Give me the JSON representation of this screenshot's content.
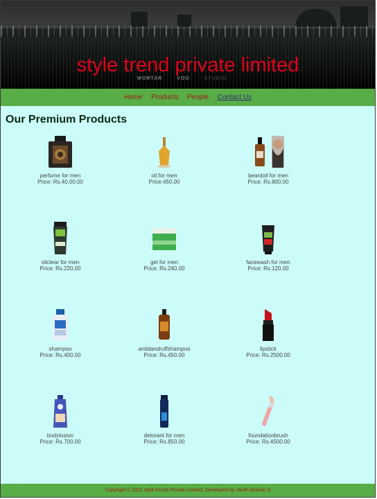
{
  "banner": {
    "title": "style trend private limited",
    "logos": [
      "MORTAR",
      "VOO",
      "STUDIO"
    ]
  },
  "nav": {
    "items": [
      "Home",
      "Products",
      "People",
      "Contact Us"
    ]
  },
  "main": {
    "heading": "Our Premium Products"
  },
  "products": [
    {
      "name": "perfume for men",
      "price": "Price: Rs.40,00.00"
    },
    {
      "name": "oil for men",
      "price": "Price:450.00"
    },
    {
      "name": "beardoil for men",
      "price": "Price: Rs.800.00"
    },
    {
      "name": "oilclear for men",
      "price": "Price: Rs.220.00"
    },
    {
      "name": "gel for men",
      "price": "Price: Rs.240.00"
    },
    {
      "name": "facewash for men",
      "price": "Price: Rs.120.00"
    },
    {
      "name": "shampoo",
      "price": "Price: Rs.400.00"
    },
    {
      "name": "antidandruffshampoo",
      "price": "Price: Rs.450.00"
    },
    {
      "name": "lipstick",
      "price": "Price: Rs.2500.00"
    },
    {
      "name": "bodylosion",
      "price": "Price: Rs.700.00"
    },
    {
      "name": "detorant for men",
      "price": "Price: Rs.850.00"
    },
    {
      "name": "foundationbrush",
      "price": "Price: Rs.4500.00"
    }
  ],
  "footer": {
    "text": "Copyright © 2021 style trends Private Limited, Developed by Javith farkhan.S"
  },
  "colors": {
    "page_bg": "#ccfcfa",
    "bar_green": "#58ad46",
    "title_red": "#e2001a",
    "nav_link": "#9b1a12"
  }
}
